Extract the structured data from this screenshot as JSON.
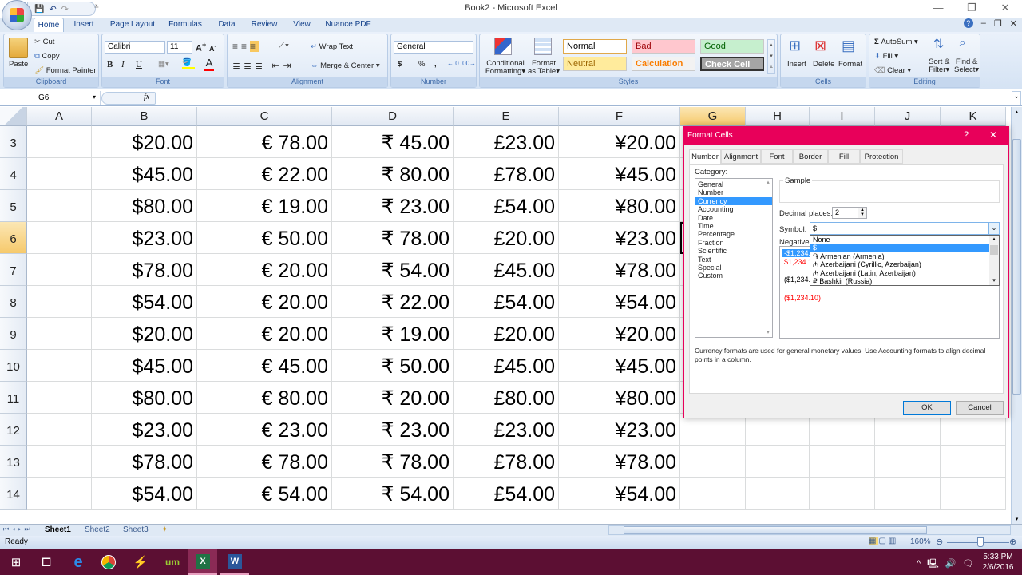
{
  "window": {
    "title": "Book2 - Microsoft Excel",
    "controls": {
      "minimize": "—",
      "restore": "❐",
      "close": "✕"
    }
  },
  "qat": {
    "save": "💾",
    "undo": "↶",
    "redo": "↷",
    "more": "⩡"
  },
  "ribbon_tabs": [
    "Home",
    "Insert",
    "Page Layout",
    "Formulas",
    "Data",
    "Review",
    "View",
    "Nuance PDF"
  ],
  "active_tab": "Home",
  "ribbon": {
    "clipboard": {
      "label": "Clipboard",
      "paste": "Paste",
      "cut": "Cut",
      "copy": "Copy",
      "format_painter": "Format Painter"
    },
    "font": {
      "label": "Font",
      "font_name": "Calibri",
      "font_size": "11",
      "bold": "B",
      "italic": "I",
      "underline": "U",
      "fill_color": "#ffff00",
      "font_color": "#ff0000"
    },
    "alignment": {
      "label": "Alignment",
      "wrap_text": "Wrap Text",
      "merge_center": "Merge & Center"
    },
    "number": {
      "label": "Number",
      "format": "General",
      "currency": "$",
      "percent": "%",
      "comma": ","
    },
    "styles": {
      "label": "Styles",
      "conditional_formatting": [
        "Conditional",
        "Formatting"
      ],
      "format_as_table": [
        "Format",
        "as Table"
      ],
      "cells": [
        {
          "name": "Normal",
          "bg": "#ffffff",
          "fg": "#000000"
        },
        {
          "name": "Bad",
          "bg": "#ffc7ce",
          "fg": "#9c0006"
        },
        {
          "name": "Good",
          "bg": "#c6efce",
          "fg": "#006100"
        },
        {
          "name": "Neutral",
          "bg": "#ffeb9c",
          "fg": "#9c6500"
        },
        {
          "name": "Calculation",
          "bg": "#f2f2f2",
          "fg": "#fa7d00"
        },
        {
          "name": "Check Cell",
          "bg": "#a5a5a5",
          "fg": "#ffffff"
        }
      ]
    },
    "cells": {
      "label": "Cells",
      "insert": "Insert",
      "delete": "Delete",
      "format": "Format"
    },
    "editing": {
      "label": "Editing",
      "autosum": "AutoSum",
      "fill": "Fill",
      "clear": "Clear",
      "sort_filter": [
        "Sort &",
        "Filter"
      ],
      "find_select": [
        "Find &",
        "Select"
      ]
    }
  },
  "formula_bar": {
    "name_box": "G6",
    "fx": "fx",
    "value": ""
  },
  "grid": {
    "columns": [
      "A",
      "B",
      "C",
      "D",
      "E",
      "F",
      "G",
      "H",
      "I",
      "J",
      "K"
    ],
    "selected_column": "G",
    "selected_row": "6",
    "rows": [
      {
        "num": "3",
        "cells": [
          "",
          "$20.00",
          "€ 78.00",
          "₹ 45.00",
          "£23.00",
          "¥20.00"
        ]
      },
      {
        "num": "4",
        "cells": [
          "",
          "$45.00",
          "€ 22.00",
          "₹ 80.00",
          "£78.00",
          "¥45.00"
        ]
      },
      {
        "num": "5",
        "cells": [
          "",
          "$80.00",
          "€ 19.00",
          "₹ 23.00",
          "£54.00",
          "¥80.00"
        ]
      },
      {
        "num": "6",
        "cells": [
          "",
          "$23.00",
          "€ 50.00",
          "₹ 78.00",
          "£20.00",
          "¥23.00"
        ]
      },
      {
        "num": "7",
        "cells": [
          "",
          "$78.00",
          "€ 20.00",
          "₹ 54.00",
          "£45.00",
          "¥78.00"
        ]
      },
      {
        "num": "8",
        "cells": [
          "",
          "$54.00",
          "€ 20.00",
          "₹ 22.00",
          "£54.00",
          "¥54.00"
        ]
      },
      {
        "num": "9",
        "cells": [
          "",
          "$20.00",
          "€ 20.00",
          "₹ 19.00",
          "£20.00",
          "¥20.00"
        ]
      },
      {
        "num": "10",
        "cells": [
          "",
          "$45.00",
          "€ 45.00",
          "₹ 50.00",
          "£45.00",
          "¥45.00"
        ]
      },
      {
        "num": "11",
        "cells": [
          "",
          "$80.00",
          "€ 80.00",
          "₹ 20.00",
          "£80.00",
          "¥80.00"
        ]
      },
      {
        "num": "12",
        "cells": [
          "",
          "$23.00",
          "€ 23.00",
          "₹ 23.00",
          "£23.00",
          "¥23.00"
        ]
      },
      {
        "num": "13",
        "cells": [
          "",
          "$78.00",
          "€ 78.00",
          "₹ 78.00",
          "£78.00",
          "¥78.00"
        ]
      },
      {
        "num": "14",
        "cells": [
          "",
          "$54.00",
          "€ 54.00",
          "₹ 54.00",
          "£54.00",
          "¥54.00"
        ]
      }
    ]
  },
  "sheets": {
    "tabs": [
      "Sheet1",
      "Sheet2",
      "Sheet3"
    ],
    "active": "Sheet1"
  },
  "status": {
    "ready": "Ready",
    "zoom": "160%"
  },
  "dialog": {
    "title": "Format Cells",
    "help": "?",
    "close": "✕",
    "tabs": [
      "Number",
      "Alignment",
      "Font",
      "Border",
      "Fill",
      "Protection"
    ],
    "active_tab": "Number",
    "category_label": "Category:",
    "categories": [
      "General",
      "Number",
      "Currency",
      "Accounting",
      "Date",
      "Time",
      "Percentage",
      "Fraction",
      "Scientific",
      "Text",
      "Special",
      "Custom"
    ],
    "selected_category": "Currency",
    "sample_label": "Sample",
    "sample_value": "",
    "decimal_places_label": "Decimal places:",
    "decimal_places": "2",
    "symbol_label": "Symbol:",
    "symbol_value": "$",
    "symbol_options": [
      "None",
      "$",
      "֏ Armenian (Armenia)",
      "₼ Azerbaijani (Cyrillic, Azerbaijan)",
      "₼ Azerbaijani (Latin, Azerbaijan)",
      "₽ Bashkir (Russia)"
    ],
    "selected_symbol": "$",
    "negative_label": "Negative numbers:",
    "negative_options": [
      {
        "text": "-$1,234.10",
        "color": "#ffffff",
        "selected": true
      },
      {
        "text": "$1,234.10",
        "color": "#ff0000",
        "selected": false
      },
      {
        "text": "($1,234.10)",
        "color": "#000000",
        "selected": false
      },
      {
        "text": "($1,234.10)",
        "color": "#ff0000",
        "selected": false
      }
    ],
    "description": "Currency formats are used for general monetary values.  Use Accounting formats to align decimal points in a column.",
    "ok": "OK",
    "cancel": "Cancel"
  },
  "taskbar": {
    "apps": [
      "start",
      "task-view",
      "edge",
      "chrome",
      "winamp",
      "ultimate-media",
      "excel",
      "word"
    ],
    "active_app": "excel",
    "time": "5:33 PM",
    "date": "2/6/2016"
  }
}
